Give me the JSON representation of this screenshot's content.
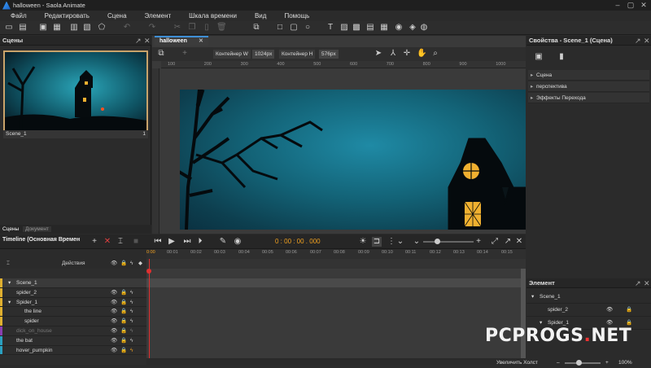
{
  "window": {
    "title": "halloween - Saola Animate"
  },
  "menu": {
    "items": [
      "Файл",
      "Редактировать",
      "Сцена",
      "Элемент",
      "Шкала времени",
      "Вид",
      "Помощь"
    ]
  },
  "scenes_panel": {
    "title": "Сцены",
    "scene_name": "Scene_1",
    "scene_index": "1",
    "tabs": [
      "Сцены",
      "Документ"
    ]
  },
  "document_tab": {
    "label": "halloween"
  },
  "canvas_toolbar": {
    "container_w_label": "Контейнер W",
    "container_w_value": "1024px",
    "container_h_label": "Контейнер H",
    "container_h_value": "576px"
  },
  "ruler": {
    "ticks": [
      "100",
      "200",
      "300",
      "400",
      "500",
      "600",
      "700",
      "800",
      "900",
      "1000"
    ]
  },
  "properties_panel": {
    "title": "Свойства - Scene_1 (Сцена)",
    "sections": [
      "Сцена",
      "перспектива",
      "Эффекты Перехода"
    ]
  },
  "timeline": {
    "title": "Timeline (Основная Времен",
    "timecode": "0 : 00 : 00 . 000",
    "actions_label": "Действия",
    "ticks": [
      "0:00",
      "00:01",
      "00:02",
      "00:03",
      "00:04",
      "00:05",
      "00:06",
      "00:07",
      "00:08",
      "00:09",
      "00:10",
      "00:11",
      "00:12",
      "00:13",
      "00:14",
      "00:15"
    ],
    "layers": [
      {
        "name": "Scene_1",
        "color": "#e0b030",
        "indent": 1
      },
      {
        "name": "spider_2",
        "color": "#e0b030",
        "indent": 2
      },
      {
        "name": "Spider_1",
        "color": "#e0b030",
        "indent": 1
      },
      {
        "name": "the line",
        "color": "#e0b030",
        "indent": 3
      },
      {
        "name": "spider",
        "color": "#e0b030",
        "indent": 3
      },
      {
        "name": "dick_on_house",
        "color": "#8a3fb0",
        "indent": 2
      },
      {
        "name": "the bat",
        "color": "#2aa0c0",
        "indent": 1
      },
      {
        "name": "hover_pumpkin",
        "color": "#2aa0c0",
        "indent": 1
      }
    ]
  },
  "element_panel": {
    "title": "Элемент",
    "items": [
      {
        "name": "Scene_1"
      },
      {
        "name": "spider_2"
      },
      {
        "name": "Spider_1"
      }
    ]
  },
  "status": {
    "zoom_label": "Увеличить Холст",
    "zoom_value": "100%"
  },
  "watermark": {
    "text": "PCPROGS",
    "dot": ".",
    "suffix": "NET"
  }
}
